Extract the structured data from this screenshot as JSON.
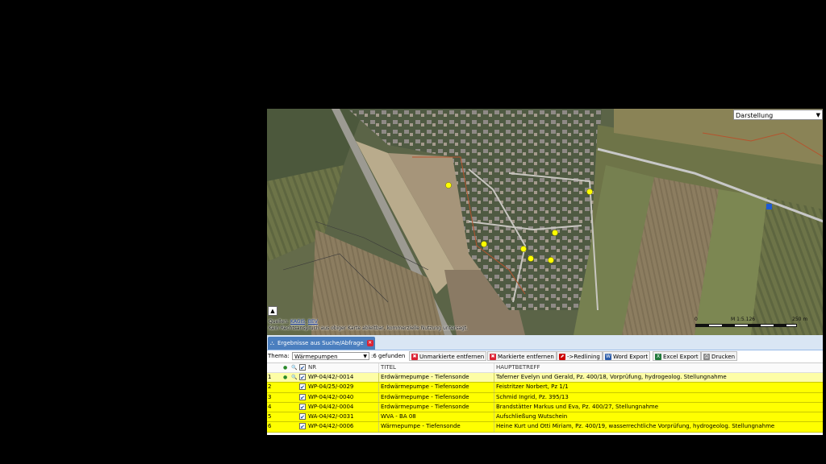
{
  "map": {
    "layer_select": "Darstellung",
    "source_label": "Quellen:",
    "source_links": [
      "KAGIS",
      "BEV"
    ],
    "source_sep": ", ",
    "disclaimer": "Kein Rechtsanspruch aus obiger Karte ableitbar, kommerzielle Nutzung untersagt.",
    "scale": {
      "start": "0",
      "ratio": "M 1:5.126",
      "end": "250 m"
    },
    "marker_color": "#ffff00",
    "marker_count": 7
  },
  "panel": {
    "tab_label": "Ergebnisse aus Suche/Abfrage",
    "theme_label": "Thema:",
    "theme_value": "Wärmepumpen",
    "found_text": ":6 gefunden",
    "buttons": [
      {
        "label": "Unmarkierte entfernen",
        "icon": "remove-unmarked-icon"
      },
      {
        "label": "Markierte entfernen",
        "icon": "remove-marked-icon"
      },
      {
        "label": "->Redlining",
        "icon": "redlining-icon"
      },
      {
        "label": "Word Export",
        "icon": "word-icon"
      },
      {
        "label": "Excel Export",
        "icon": "excel-icon"
      },
      {
        "label": "Drucken",
        "icon": "print-icon"
      }
    ]
  },
  "table": {
    "columns": {
      "nr": "NR",
      "titel": "TITEL",
      "hauptbetreff": "HAUPTBETREFF"
    },
    "rows": [
      {
        "idx": "1",
        "nr": "WP-04/42/-0014",
        "titel": "Erdwärmepumpe - Tiefensonde",
        "hauptbetreff": "Taferner Evelyn und Gerald, Pz. 400/18, Vorprüfung, hydrogeolog. Stellungnahme"
      },
      {
        "idx": "2",
        "nr": "WP-04/25/-0029",
        "titel": "Erdwärmepumpe - Tiefensonde",
        "hauptbetreff": "Feistritzer Norbert, Pz 1/1"
      },
      {
        "idx": "3",
        "nr": "WP-04/42/-0040",
        "titel": "Erdwärmepumpe - Tiefensonde",
        "hauptbetreff": "Schmid Ingrid, Pz. 395/13"
      },
      {
        "idx": "4",
        "nr": "WP-04/42/-0004",
        "titel": "Erdwärmepumpe - Tiefensonde",
        "hauptbetreff": "Brandstätter Markus und Eva, Pz. 400/27, Stellungnahme"
      },
      {
        "idx": "5",
        "nr": "WA-04/42/-0031",
        "titel": "WVA - BA 08",
        "hauptbetreff": "Aufschließung Wutschein"
      },
      {
        "idx": "6",
        "nr": "WP-04/42/-0006",
        "titel": "Wärmepumpe - Tiefensonde",
        "hauptbetreff": "Heine Kurt und Otti Miriam, Pz. 400/19, wasserrechtliche Vorprüfung, hydrogeolog. Stellungnahme"
      }
    ]
  }
}
